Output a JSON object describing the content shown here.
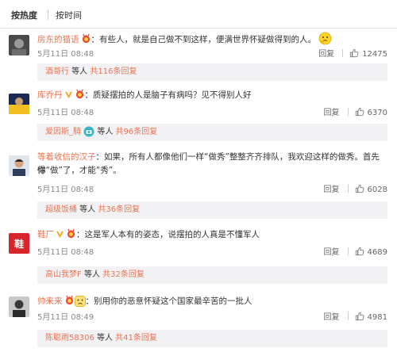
{
  "sort": {
    "hot": "按热度",
    "time": "按时间"
  },
  "actions": {
    "reply": "回复"
  },
  "comments": [
    {
      "user": "房东的猫语",
      "text": "有些人，就是自己做不到这样，便满世界怀疑做得到的人。",
      "time": "5月11日 08:48",
      "likes": "12475",
      "reply_user": "酒哥行",
      "reply_mid": " 等人 ",
      "reply_count": "共116条回复"
    },
    {
      "user": "库乔丹",
      "text": "质疑摆拍的人是脑子有病吗？见不得别人好",
      "time": "5月11日 08:48",
      "likes": "6370",
      "reply_user": "爱因斯_騎",
      "reply_mid": " 等人 ",
      "reply_count": "共96条回复"
    },
    {
      "user": "等着收信的汉子",
      "text": "如果，所有人都像他们一样“做秀”整整齐齐排队，我欢迎这样的做秀。首先你",
      "text2": "得“做”了，才能“秀”。",
      "time": "5月11日 08:48",
      "likes": "6028",
      "reply_user": "超级饭桶",
      "reply_mid": " 等人 ",
      "reply_count": "共36条回复"
    },
    {
      "user": "鞋厂",
      "text": "这是军人本有的姿态，说摆拍的人真是不懂军人",
      "time": "5月11日 08:48",
      "likes": "4689",
      "reply_user": "高山我梦F",
      "reply_mid": " 等人 ",
      "reply_count": "共32条回复"
    },
    {
      "user": "帅来来",
      "text": "别用你的恶意怀疑这个国家最辛苦的一批人",
      "time": "5月11日 08:49",
      "likes": "4981",
      "reply_user": "陈聪雨58306",
      "reply_mid": " 等人 ",
      "reply_count": "共41条回复"
    }
  ]
}
